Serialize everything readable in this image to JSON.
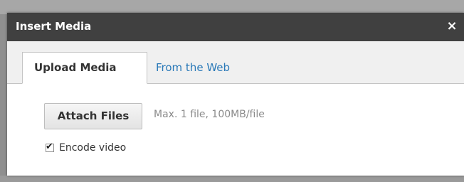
{
  "dialog": {
    "title": "Insert Media",
    "close_label": "×"
  },
  "tabs": [
    {
      "label": "Upload Media",
      "active": true
    },
    {
      "label": "From the Web",
      "active": false
    }
  ],
  "upload": {
    "attach_label": "Attach Files",
    "hint": "Max. 1 file, 100MB/file",
    "encode_label": "Encode video",
    "encode_checked": true,
    "checkmark": "✔"
  },
  "colors": {
    "header_bg": "#404040",
    "link": "#2a79b8",
    "tab_bar_bg": "#f0f0f0"
  }
}
